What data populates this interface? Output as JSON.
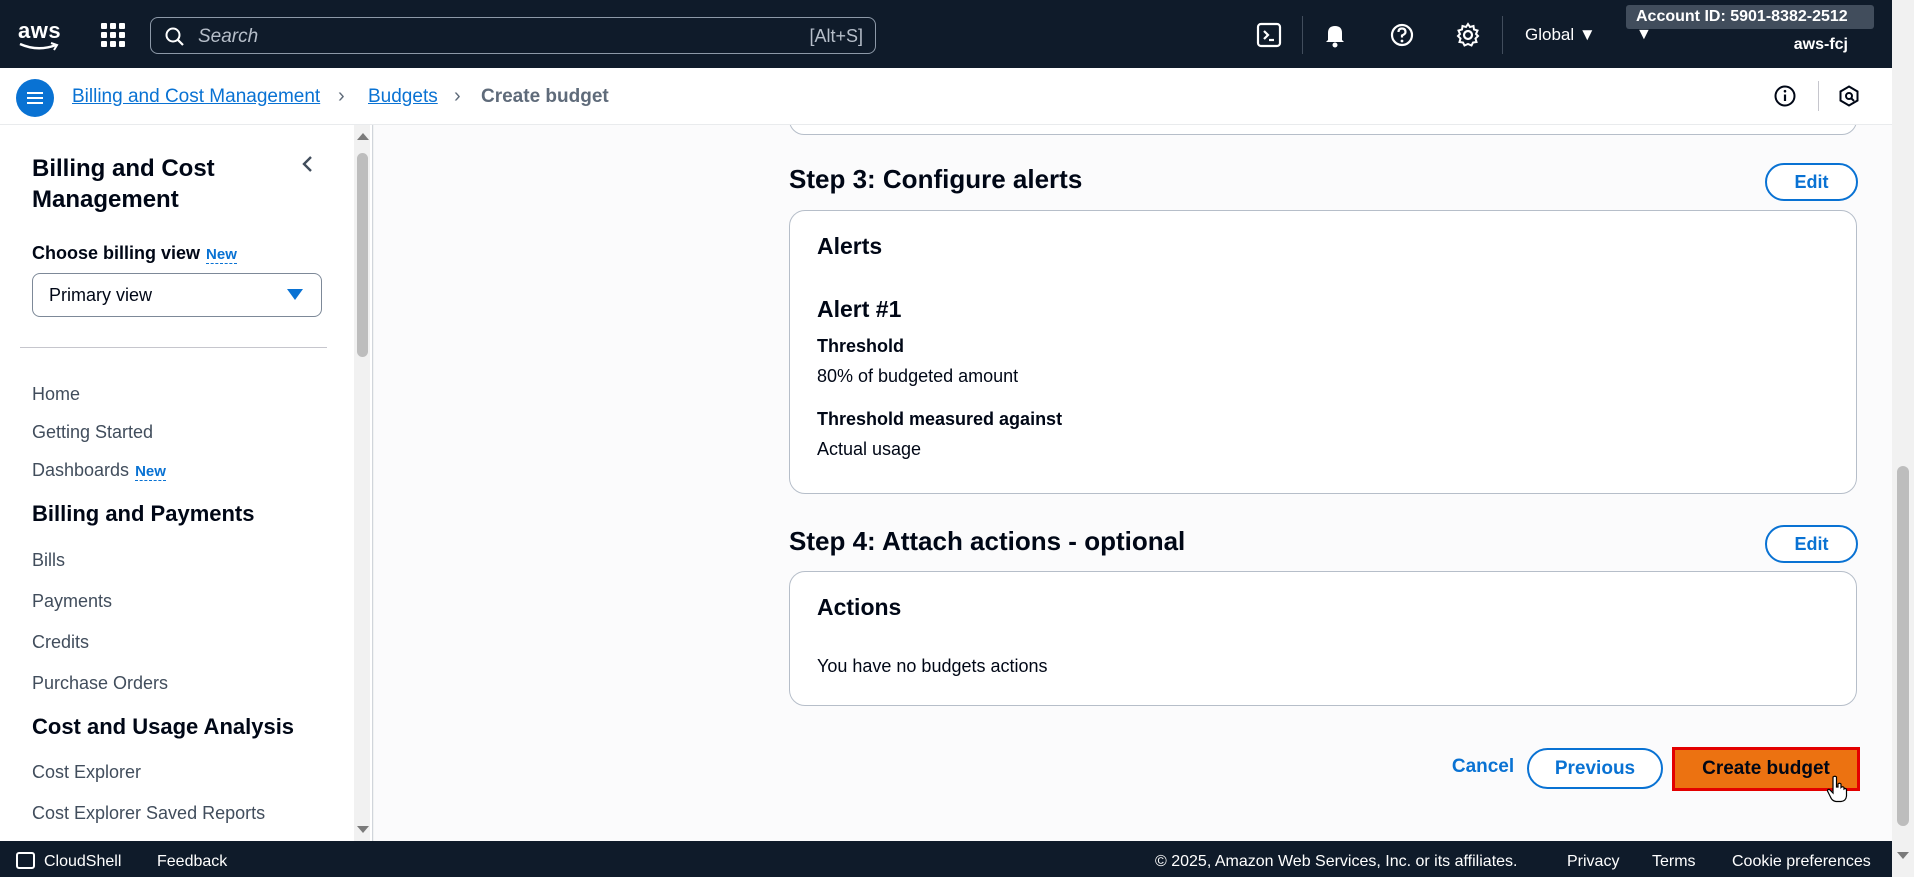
{
  "topbar": {
    "logo_text": "aws",
    "search_placeholder": "Search",
    "search_shortcut": "[Alt+S]",
    "region": "Global ▼",
    "account_id": "Account ID: 5901-8382-2512 ▼",
    "account_user": "aws-fcj"
  },
  "breadcrumb": {
    "items": [
      "Billing and Cost Management",
      "Budgets",
      "Create budget"
    ]
  },
  "sidebar": {
    "title": "Billing and Cost Management",
    "billing_view_label": "Choose billing view",
    "new_badge": "New",
    "billing_view_value": "Primary view",
    "nav_top": [
      "Home",
      "Getting Started",
      "Dashboards"
    ],
    "dashboards_badge": "New",
    "section_billing": "Billing and Payments",
    "billing_items": [
      "Bills",
      "Payments",
      "Credits",
      "Purchase Orders"
    ],
    "section_cost": "Cost and Usage Analysis",
    "cost_items": [
      "Cost Explorer",
      "Cost Explorer Saved Reports"
    ]
  },
  "main": {
    "step3": {
      "title": "Step 3: Configure alerts",
      "edit": "Edit",
      "card_title": "Alerts",
      "alert_title": "Alert #1",
      "threshold_label": "Threshold",
      "threshold_value": "80% of budgeted amount",
      "measured_label": "Threshold measured against",
      "measured_value": "Actual usage"
    },
    "step4": {
      "title": "Step 4: Attach actions - optional",
      "edit": "Edit",
      "card_title": "Actions",
      "empty_text": "You have no budgets actions"
    },
    "actions": {
      "cancel": "Cancel",
      "previous": "Previous",
      "create": "Create budget"
    }
  },
  "footer": {
    "cloudshell": "CloudShell",
    "feedback": "Feedback",
    "copyright": "© 2025, Amazon Web Services, Inc. or its affiliates.",
    "privacy": "Privacy",
    "terms": "Terms",
    "cookies": "Cookie preferences"
  },
  "colors": {
    "nav_dark": "#0f1b2a",
    "link_blue": "#0972d3",
    "primary_orange": "#ec7211",
    "highlight_red": "#e30000"
  }
}
